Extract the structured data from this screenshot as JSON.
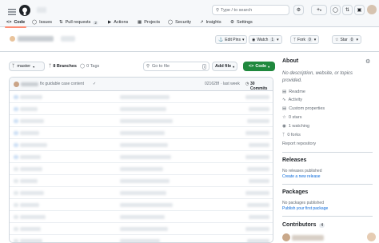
{
  "header": {
    "search_placeholder": "Type / to search",
    "search_kbd": "/"
  },
  "tabs": [
    {
      "label": "Code",
      "count": ""
    },
    {
      "label": "Issues",
      "count": ""
    },
    {
      "label": "Pull requests",
      "count": "2"
    },
    {
      "label": "Actions",
      "count": ""
    },
    {
      "label": "Projects",
      "count": ""
    },
    {
      "label": "Security",
      "count": ""
    },
    {
      "label": "Insights",
      "count": ""
    },
    {
      "label": "Settings",
      "count": ""
    }
  ],
  "repo_actions": {
    "edit_pins": "Edit Pins",
    "watch": "Watch",
    "watch_count": "1",
    "fork": "Fork",
    "fork_count": "0",
    "star": "Star",
    "star_count": "0"
  },
  "toolbar": {
    "branch": "master",
    "branches": "8 Branches",
    "tags": "0 Tags",
    "goto_placeholder": "Go to file",
    "goto_kbd": "t",
    "add_file": "Add file",
    "code": "Code"
  },
  "commit": {
    "message": "fix guidable case content",
    "hash": "021628f",
    "time": "last week",
    "commits": "30 Commits"
  },
  "about": {
    "title": "About",
    "description": "No description, website, or topics provided.",
    "items": [
      "Readme",
      "Activity",
      "Custom properties",
      "0 stars",
      "1 watching",
      "0 forks"
    ],
    "report": "Report repository"
  },
  "releases": {
    "title": "Releases",
    "none": "No releases published",
    "link": "Create a new release"
  },
  "packages": {
    "title": "Packages",
    "none": "No packages published",
    "link": "Publish your first package"
  },
  "contributors": {
    "title": "Contributors",
    "count": "4"
  },
  "colors": {
    "accent": "#0969da",
    "green": "#1f883d",
    "tab_underline": "#fd8c73",
    "border": "#d0d7de"
  }
}
